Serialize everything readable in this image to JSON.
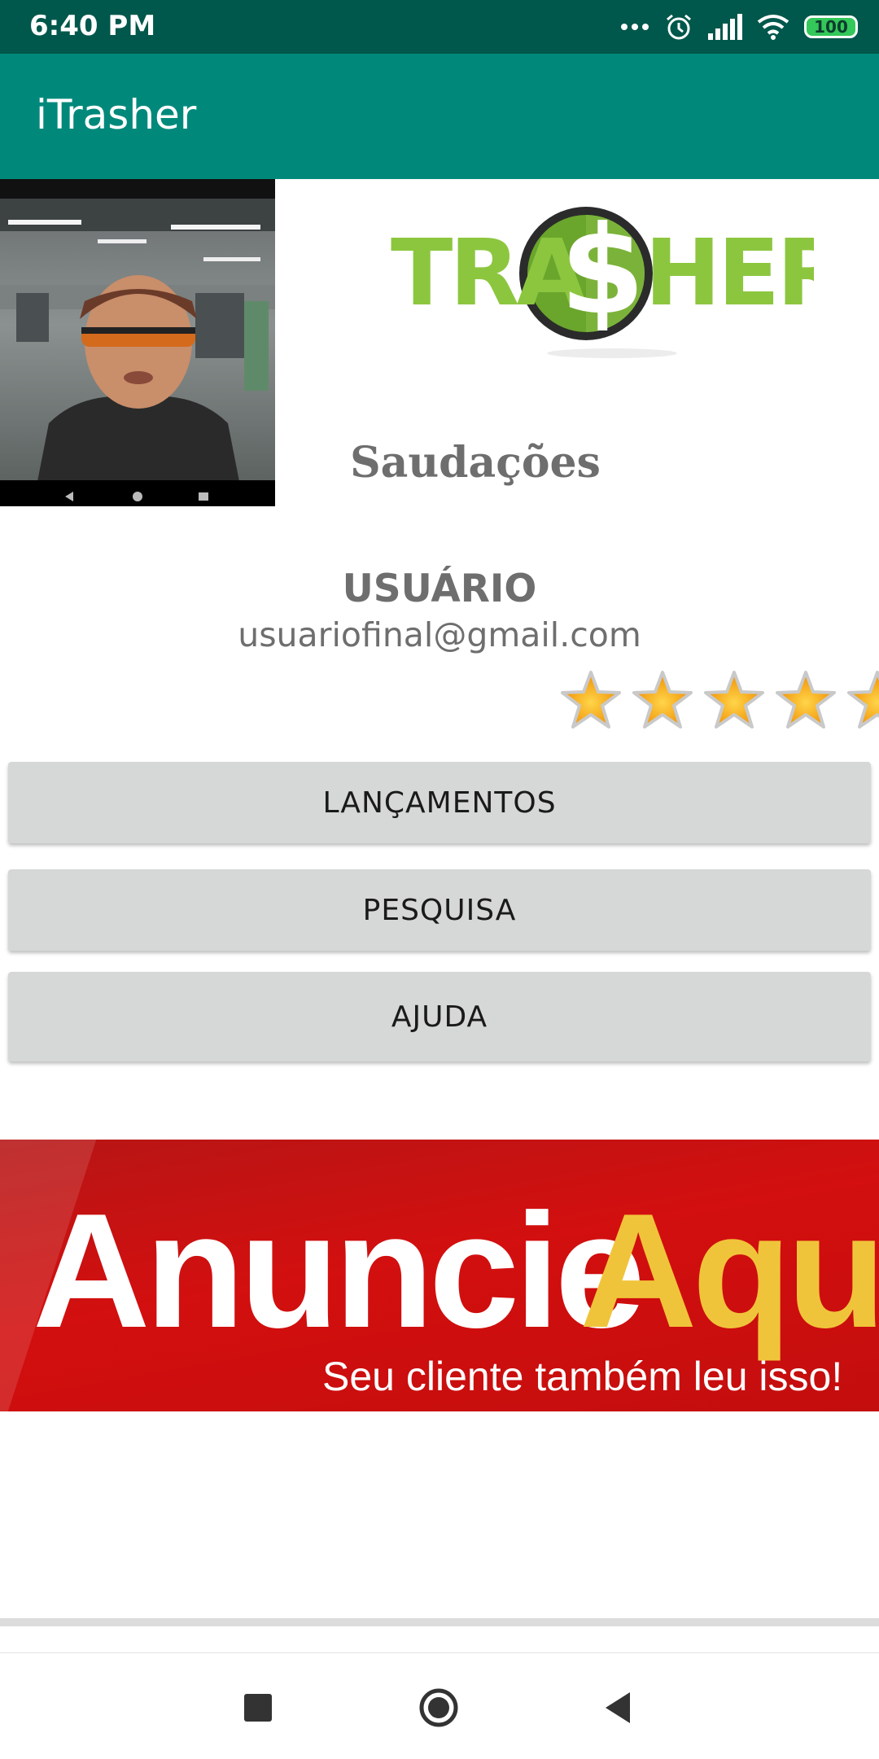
{
  "status_bar": {
    "time": "6:40 PM",
    "battery": "100",
    "icons": [
      "more-dots-icon",
      "alarm-icon",
      "signal-icon",
      "wifi-icon",
      "battery-icon"
    ]
  },
  "app_bar": {
    "title": "iTrasher"
  },
  "profile": {
    "greeting": "Saudações",
    "username": "USUÁRIO",
    "email": "usuariofinal@gmail.com",
    "rating_stars_visible": 5
  },
  "logo": {
    "text_left": "TRA",
    "text_symbol": "$",
    "text_right": "HER"
  },
  "buttons": {
    "releases": "LANÇAMENTOS",
    "search": "PESQUISA",
    "help": "AJUDA"
  },
  "ad_banner": {
    "word1": "Anuncie",
    "word2": "Aqui",
    "subtitle": "Seu cliente também leu isso!"
  },
  "nav_bar": {
    "icons": [
      "recents-square-icon",
      "home-circle-icon",
      "back-triangle-icon"
    ]
  },
  "colors": {
    "status_bar": "#00574b",
    "app_bar": "#00897b",
    "button_bg": "#d6d7d7",
    "logo_green": "#8cc63f",
    "ad_red": "#d30f0f",
    "ad_yellow": "#f0c43a"
  }
}
